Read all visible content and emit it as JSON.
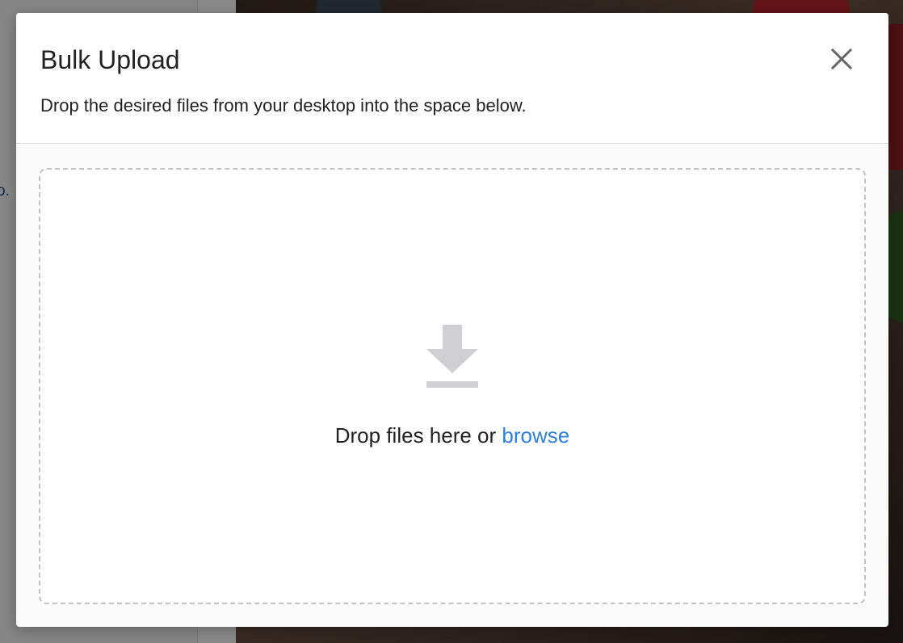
{
  "background": {
    "left_snippet": "o."
  },
  "modal": {
    "title": "Bulk Upload",
    "subtitle": "Drop the desired files from your desktop into the space below.",
    "close_icon": "close-icon"
  },
  "dropzone": {
    "icon": "download-icon",
    "prompt": "Drop files here or",
    "browse_label": "browse"
  },
  "colors": {
    "link": "#2f7fd8",
    "icon": "#cfcfd4",
    "overlay": "rgba(0,0,0,0.45)"
  }
}
